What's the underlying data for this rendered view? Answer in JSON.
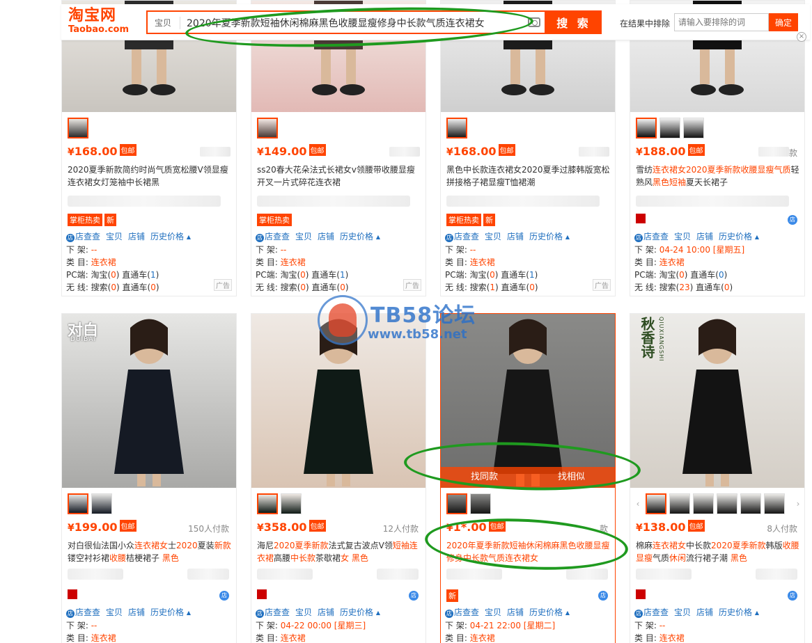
{
  "header": {
    "logo_cn": "淘宝网",
    "logo_en": "Taobao.com",
    "search_scope": "宝贝",
    "search_query": "2020年夏季新款短袖休闲棉麻黑色收腰显瘦修身中长款气质连衣裙女",
    "search_button": "搜 索",
    "exclude_label": "在结果中排除",
    "exclude_placeholder": "请输入要排除的词",
    "exclude_button": "确定",
    "close_glyph": "×"
  },
  "plugin_labels": {
    "shop_check": "店查查",
    "item": "宝贝",
    "shop": "店铺",
    "history": "历史价格",
    "off_shelf": "下 架:",
    "category": "类 目:",
    "pc": "PC端:",
    "taobao": "淘宝(",
    "ztc": "直通车(",
    "wireless": "无 线:",
    "search": "搜索(",
    "close_paren": ")",
    "arrow": "▲",
    "d": "店"
  },
  "ad_label": "广告",
  "hover_actions": [
    "找同款",
    "找相似"
  ],
  "watermark": {
    "title": "TB58论坛",
    "url": "www.tb58.net"
  },
  "yen": "¥",
  "baoyou": "包邮",
  "row1": [
    {
      "price": "168.00",
      "title": "2020夏季新款简约时尚气质宽松腰V领显瘦连衣裙女灯笼袖中长裙黑",
      "tags": [
        "掌柜热卖",
        "新"
      ],
      "off_shelf": "--",
      "category": "连衣裙",
      "pc_taobao": "0",
      "pc_ztc": "1",
      "wl_search": "0",
      "wl_ztc": "0",
      "colors": [
        "#e9e6e1",
        "#c9c5bf",
        "#2b2b2b"
      ]
    },
    {
      "price": "149.00",
      "title": "ss20春大花朵法式长裙女v领腰带收腰显瘦开叉一片式碎花连衣裙",
      "tags": [
        "掌柜热卖"
      ],
      "off_shelf": "--",
      "category": "连衣裙",
      "pc_taobao": "0",
      "pc_ztc": "1",
      "wl_search": "0",
      "wl_ztc": "0",
      "colors": [
        "#f3e8e4",
        "#e2b9b5",
        "#4a3a36"
      ]
    },
    {
      "price": "168.00",
      "title": "黑色中长款连衣裙女2020夏季过膝韩版宽松拼接格子裙显瘦T恤裙潮",
      "tags": [
        "掌柜热卖",
        "新"
      ],
      "off_shelf": "--",
      "category": "连衣裙",
      "pc_taobao": "0",
      "pc_ztc": "1",
      "wl_search": "1",
      "wl_ztc": "0",
      "colors": [
        "#efefef",
        "#cfcfcf",
        "#1c1c1c"
      ]
    },
    {
      "price": "188.00",
      "sales_unit": "款",
      "title_parts": [
        "雪纺",
        "连衣裙女2020夏季新款收腰显瘦气质",
        "轻熟风",
        "黑色短袖",
        "夏天长裙子"
      ],
      "off_shelf": "04-24 10:00 [星期五]",
      "category": "连衣裙",
      "pc_taobao": "0",
      "pc_ztc": "0",
      "wl_search": "23",
      "wl_ztc": "0",
      "colors": [
        "#f2f2f2",
        "#d8d8d8",
        "#111111"
      ]
    }
  ],
  "row2": [
    {
      "price": "199.00",
      "sales": "150人付款",
      "title_parts": [
        "对白很仙法国小众",
        "连衣裙女",
        "士",
        "2020",
        "夏装",
        "新款",
        "镂空衬衫裙",
        "收腰",
        "桔梗裙子 ",
        "黑色"
      ],
      "brand": "对白",
      "brand_en": "DUIBAI",
      "off_shelf": "--",
      "category": "连衣裙",
      "colors": [
        "#e6e6e4",
        "#a9a9a7",
        "#151a24"
      ]
    },
    {
      "price": "358.00",
      "sales": "12人付款",
      "title_parts": [
        "海尼",
        "2020夏季新款",
        "法式复古波点V领",
        "短袖连衣裙",
        "高腰",
        "中长款",
        "茶歇裙",
        "女 黑色"
      ],
      "off_shelf": "04-22 00:00 [星期三]",
      "category": "连衣裙",
      "colors": [
        "#efe9e4",
        "#d9c4b3",
        "#0f1a16"
      ]
    },
    {
      "price": "1*.00",
      "sales": "款",
      "title": "2020年夏季新款短袖休闲棉麻黑色收腰显瘦修身中长款气质连衣裙女",
      "tags": [
        "新"
      ],
      "off_shelf": "04-21 22:00 [星期二]",
      "category": "连衣裙",
      "colors": [
        "#8a8a88",
        "#6d6d6c",
        "#161616"
      ]
    },
    {
      "price": "138.00",
      "sales": "8人付款",
      "title_parts": [
        "棉麻",
        "连衣裙女",
        "中长款",
        "2020夏季新款",
        "韩版",
        "收腰显瘦",
        "气质",
        "休闲",
        "流行裙子潮 ",
        "黑色"
      ],
      "brand": "秋香诗",
      "brand_en": "QIUXIANGSHI",
      "off_shelf": "--",
      "category": "连衣裙",
      "colors": [
        "#ecebe8",
        "#d4cec6",
        "#131313"
      ]
    }
  ]
}
